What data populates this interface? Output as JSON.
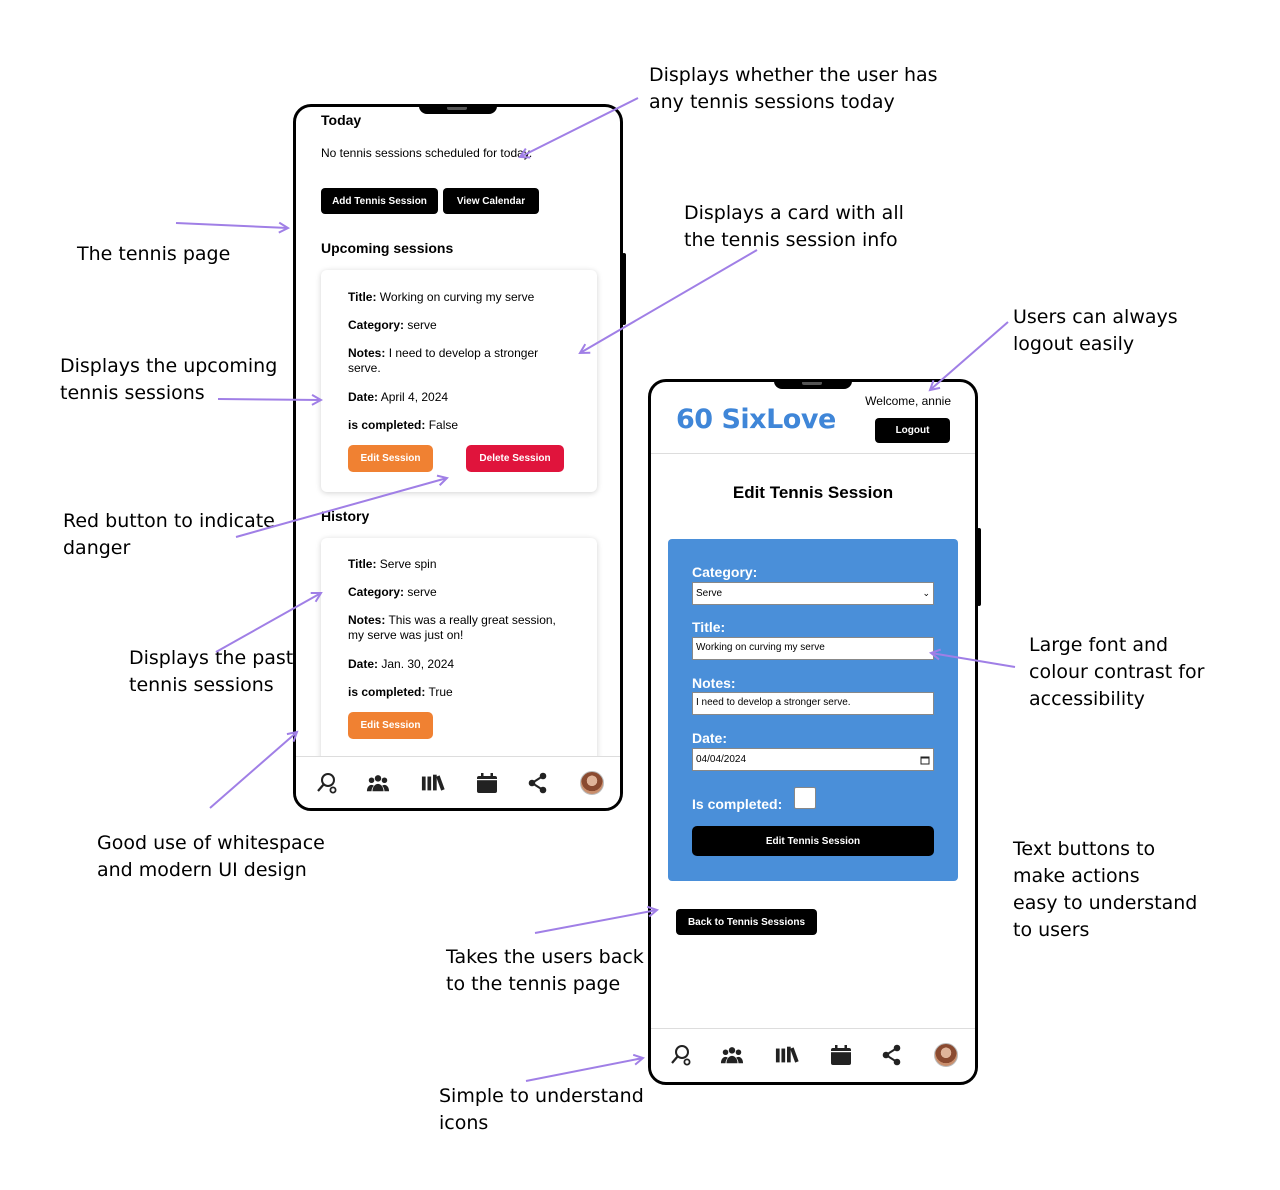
{
  "annotations": {
    "sessions_today": "Displays whether the user has\nany tennis sessions today",
    "tennis_page": "The tennis page",
    "card_info": "Displays a card with all\nthe tennis session info",
    "upcoming": "Displays the upcoming\ntennis sessions",
    "logout": "Users can always\nlogout easily",
    "danger": "Red button to indicate\ndanger",
    "past": "Displays the past\ntennis sessions",
    "accessibility": "Large font and\ncolour contrast for\naccessibility",
    "whitespace": "Good use of whitespace\nand modern UI design",
    "text_buttons": "Text buttons to\nmake actions\neasy to understand\nto users",
    "back": "Takes the users back\nto the tennis page",
    "icons": "Simple to understand\nicons"
  },
  "tennis_page": {
    "today_heading": "Today",
    "today_message": "No tennis sessions scheduled for today.",
    "add_button": "Add Tennis Session",
    "calendar_button": "View Calendar",
    "upcoming_heading": "Upcoming sessions",
    "upcoming": {
      "title_label": "Title:",
      "title": "Working on curving my serve",
      "category_label": "Category:",
      "category": "serve",
      "notes_label": "Notes:",
      "notes": "I need to develop a stronger serve.",
      "date_label": "Date:",
      "date": "April 4, 2024",
      "completed_label": "is completed:",
      "completed": "False",
      "edit_button": "Edit Session",
      "delete_button": "Delete Session"
    },
    "history_heading": "History",
    "history": {
      "title_label": "Title:",
      "title": "Serve spin",
      "category_label": "Category:",
      "category": "serve",
      "notes_label": "Notes:",
      "notes": "This was a really great session, my serve was just on!",
      "date_label": "Date:",
      "date": "Jan. 30, 2024",
      "completed_label": "is completed:",
      "completed": "True",
      "edit_button": "Edit Session"
    }
  },
  "edit_page": {
    "logo": "SixLove",
    "welcome": "Welcome, annie",
    "logout": "Logout",
    "title": "Edit Tennis Session",
    "category_label": "Category:",
    "category_value": "Serve",
    "title_label": "Title:",
    "title_value": "Working on curving my serve",
    "notes_label": "Notes:",
    "notes_value": "I need to develop a stronger serve.",
    "date_label": "Date:",
    "date_value": "04/04/2024",
    "completed_label": "Is completed:",
    "submit_button": "Edit Tennis Session",
    "back_button": "Back to Tennis Sessions"
  },
  "nav_icons": [
    "racket-icon",
    "group-icon",
    "library-icon",
    "calendar-icon",
    "share-icon",
    "profile-avatar"
  ],
  "colors": {
    "accent_blue": "#4a8fd9",
    "logo_blue": "#3f86d8",
    "edit_orange": "#f08132",
    "delete_red": "#e0143c",
    "arrow_purple": "#a07fe6"
  }
}
